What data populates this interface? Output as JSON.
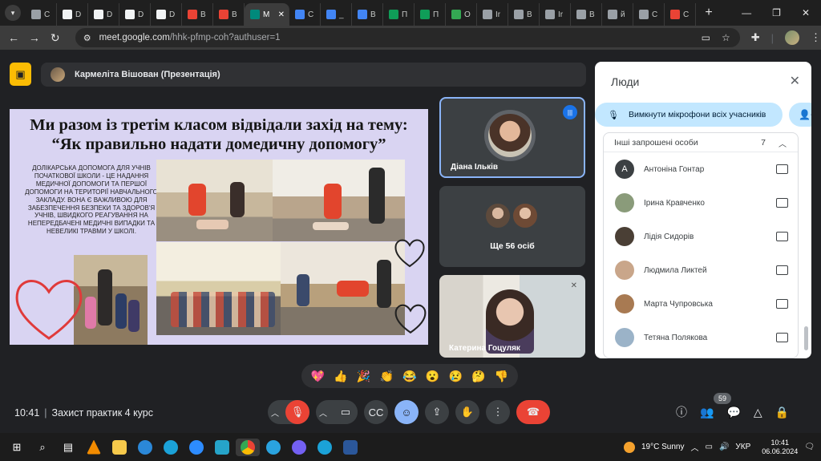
{
  "browser": {
    "tabs": [
      {
        "title": "С",
        "color": "#9aa0a6"
      },
      {
        "title": "D",
        "color": "#f1f3f4"
      },
      {
        "title": "D",
        "color": "#f1f3f4"
      },
      {
        "title": "D",
        "color": "#f1f3f4"
      },
      {
        "title": "D",
        "color": "#f1f3f4"
      },
      {
        "title": "В",
        "color": "#ea4335"
      },
      {
        "title": "В",
        "color": "#ea4335"
      },
      {
        "title": "M",
        "color": "#00897b",
        "active": true
      },
      {
        "title": "С",
        "color": "#4285f4"
      },
      {
        "title": "_",
        "color": "#4285f4"
      },
      {
        "title": "В",
        "color": "#4285f4"
      },
      {
        "title": "П",
        "color": "#0f9d58"
      },
      {
        "title": "П",
        "color": "#0f9d58"
      },
      {
        "title": "О",
        "color": "#34a853"
      },
      {
        "title": "Ir",
        "color": "#9aa0a6"
      },
      {
        "title": "В",
        "color": "#9aa0a6"
      },
      {
        "title": "Ir",
        "color": "#9aa0a6"
      },
      {
        "title": "В",
        "color": "#9aa0a6"
      },
      {
        "title": "й",
        "color": "#9aa0a6"
      },
      {
        "title": "С",
        "color": "#9aa0a6"
      },
      {
        "title": "С",
        "color": "#ea4335"
      }
    ],
    "url_host": "meet.google.com",
    "url_path": "/hhk-pfmp-coh?authuser=1"
  },
  "meet": {
    "presenter_banner": "Кармеліта Вішован (Презентація)",
    "slide": {
      "title_line1": "Ми разом із третім класом відвідали захід на тему:",
      "title_line2": "“Як правильно надати домедичну допомогу”",
      "body": "Долікарська допомога для учнів початкової школи - це надання медичної допомоги та першої допомоги на території навчального закладу. Вона є важливою для забезпечення безпеки та здоров'я учнів, швидкого реагування на непередбачені медичні випадки та невеликі травми у школі."
    },
    "tiles": {
      "tile1_name": "Діана Ільків",
      "tile2_label": "Ще 56 осіб",
      "tile3_name": "Катерина Гоцуляк"
    },
    "reactions": [
      "💖",
      "👍",
      "🎉",
      "👏",
      "😂",
      "😮",
      "😢",
      "🤔",
      "👎"
    ],
    "people_panel": {
      "title": "Люди",
      "mute_all": "Вимкнути мікрофони всіх учасників",
      "group_label": "Інші запрошені особи",
      "group_count": "7",
      "people": [
        {
          "name": "Антоніна Гонтар",
          "initial": "А",
          "color": "#3c4043"
        },
        {
          "name": "Ірина Кравченко",
          "initial": "",
          "color": "#8a9b7a"
        },
        {
          "name": "Лідія Сидорів",
          "initial": "",
          "color": "#4a3f35"
        },
        {
          "name": "Людмила Ликтей",
          "initial": "",
          "color": "#c9a68a"
        },
        {
          "name": "Марта Чупровська",
          "initial": "",
          "color": "#a87a52"
        },
        {
          "name": "Тетяна Полякова",
          "initial": "",
          "color": "#9bb3c8"
        }
      ]
    },
    "bottom": {
      "time": "10:41",
      "meeting_name": "Захист практик 4 курс",
      "people_count": "59"
    }
  },
  "taskbar": {
    "weather": "19°C  Sunny",
    "lang": "УКР",
    "time": "10:41",
    "date": "06.06.2024"
  }
}
